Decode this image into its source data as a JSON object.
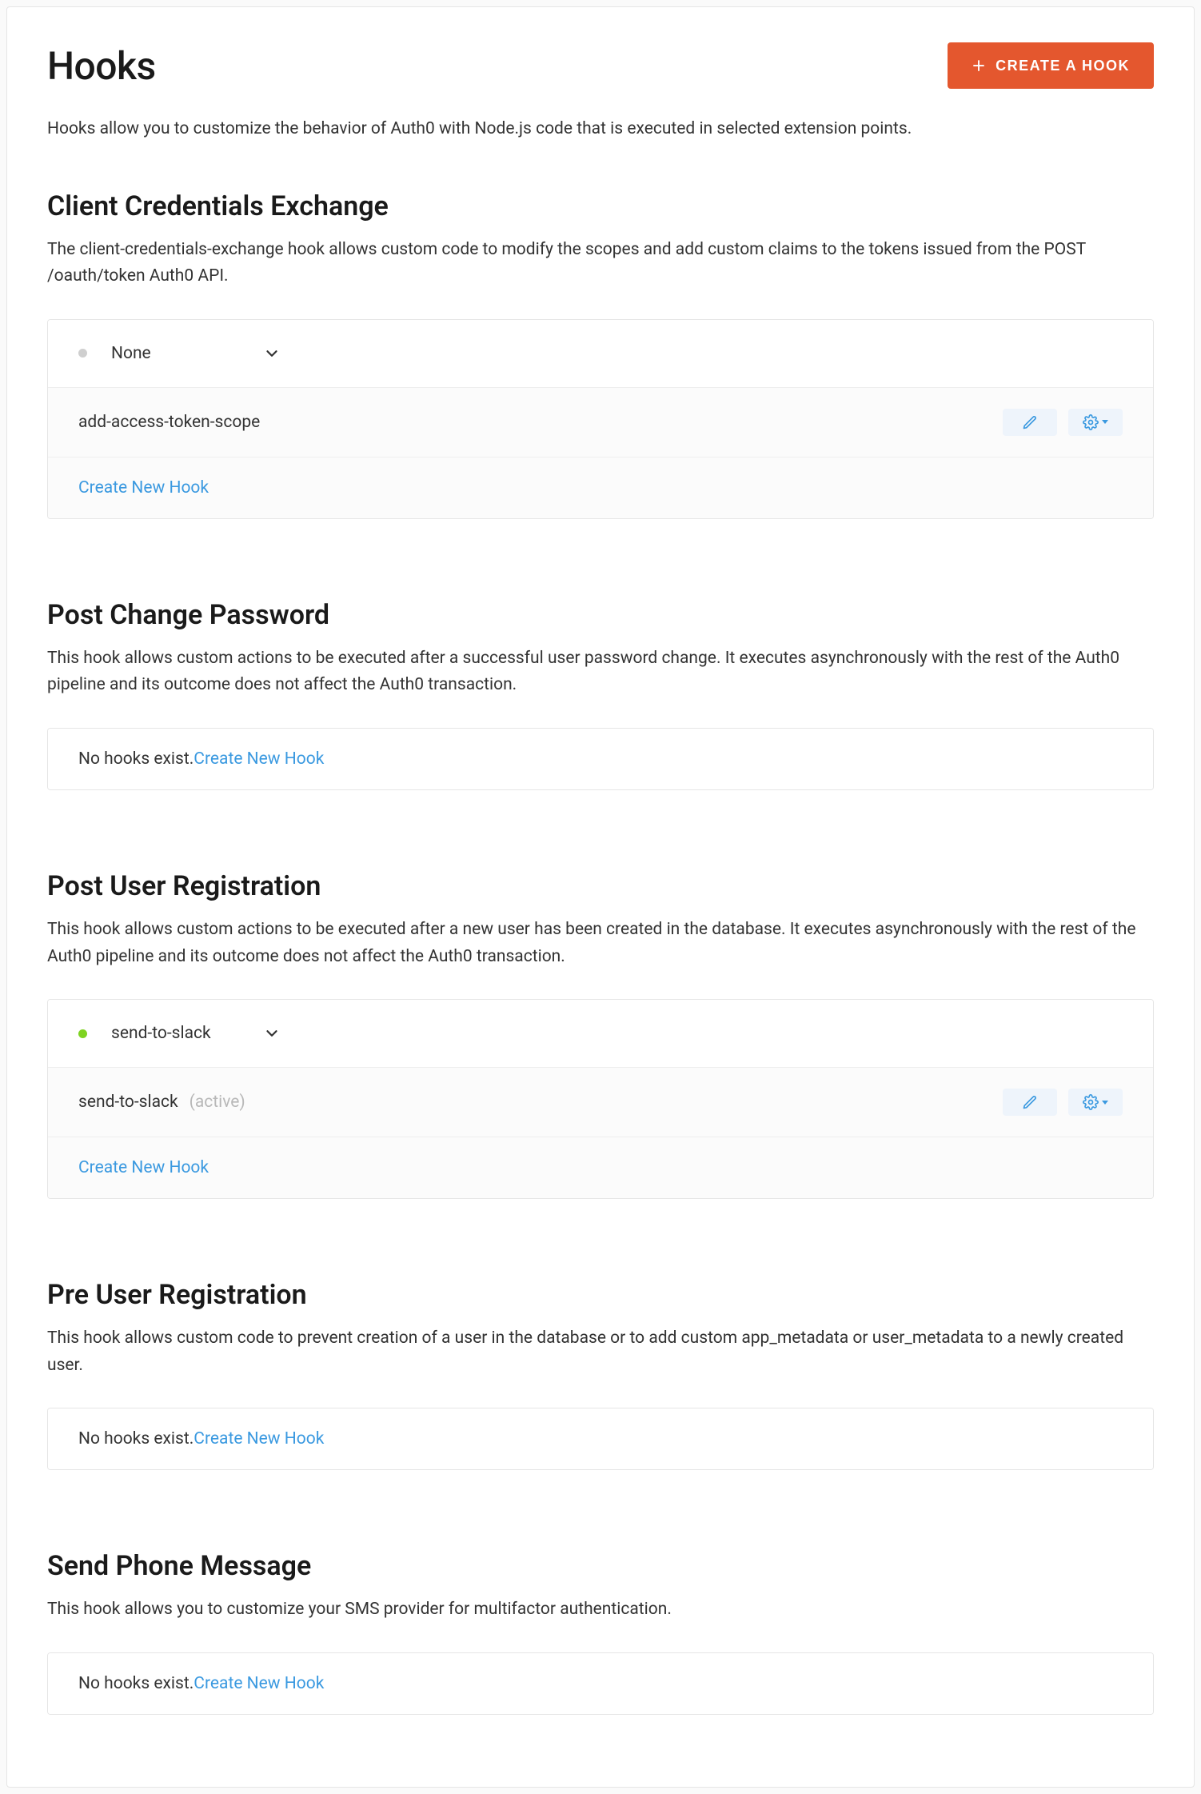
{
  "header": {
    "title": "Hooks",
    "create_button": "CREATE A HOOK"
  },
  "intro": "Hooks allow you to customize the behavior of Auth0 with Node.js code that is executed in selected extension points.",
  "sections": {
    "cce": {
      "title": "Client Credentials Exchange",
      "desc": "The client-credentials-exchange hook allows custom code to modify the scopes and add custom claims to the tokens issued from the POST /oauth/token Auth0 API.",
      "selector_value": "None",
      "hook_name": "add-access-token-scope",
      "create_link": "Create New Hook"
    },
    "pcp": {
      "title": "Post Change Password",
      "desc": "This hook allows custom actions to be executed after a successful user password change. It executes asynchronously with the rest of the Auth0 pipeline and its outcome does not affect the Auth0 transaction.",
      "empty_prefix": "No hooks exist. ",
      "create_link": "Create New Hook"
    },
    "pur": {
      "title": "Post User Registration",
      "desc": "This hook allows custom actions to be executed after a new user has been created in the database. It executes asynchronously with the rest of the Auth0 pipeline and its outcome does not affect the Auth0 transaction.",
      "selector_value": "send-to-slack",
      "hook_name": "send-to-slack",
      "hook_status": "(active)",
      "create_link": "Create New Hook"
    },
    "preur": {
      "title": "Pre User Registration",
      "desc": "This hook allows custom code to prevent creation of a user in the database or to add custom app_metadata or user_metadata to a newly created user.",
      "empty_prefix": "No hooks exist. ",
      "create_link": "Create New Hook"
    },
    "spm": {
      "title": "Send Phone Message",
      "desc": "This hook allows you to customize your SMS provider for multifactor authentication.",
      "empty_prefix": "No hooks exist. ",
      "create_link": "Create New Hook"
    }
  }
}
